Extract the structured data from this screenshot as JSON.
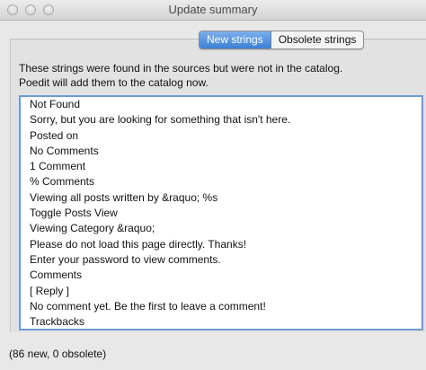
{
  "window": {
    "title": "Update summary",
    "controls": [
      "close-button",
      "minimize-button",
      "zoom-button"
    ]
  },
  "tabs": [
    {
      "label": "New strings",
      "active": true
    },
    {
      "label": "Obsolete strings",
      "active": false
    }
  ],
  "description": {
    "line1": "These strings were found in the sources but were not in the catalog.",
    "line2": "Poedit will add them to the catalog now."
  },
  "strings": [
    "Not Found",
    "Sorry, but you are looking for something that isn't here.",
    "Posted on",
    "No Comments",
    "1 Comment",
    "% Comments",
    "Viewing all posts written by &raquo; %s",
    "Toggle Posts View",
    "Viewing Category &raquo;",
    "Please do not load this page directly. Thanks!",
    "Enter your password to view comments.",
    "Comments",
    "[ Reply ]",
    "No comment yet. Be the first to leave a comment!",
    "Trackbacks"
  ],
  "status": "(86 new, 0 obsolete)",
  "colors": {
    "accent": "#3c7fd6",
    "list_border": "#6c9ad6"
  }
}
